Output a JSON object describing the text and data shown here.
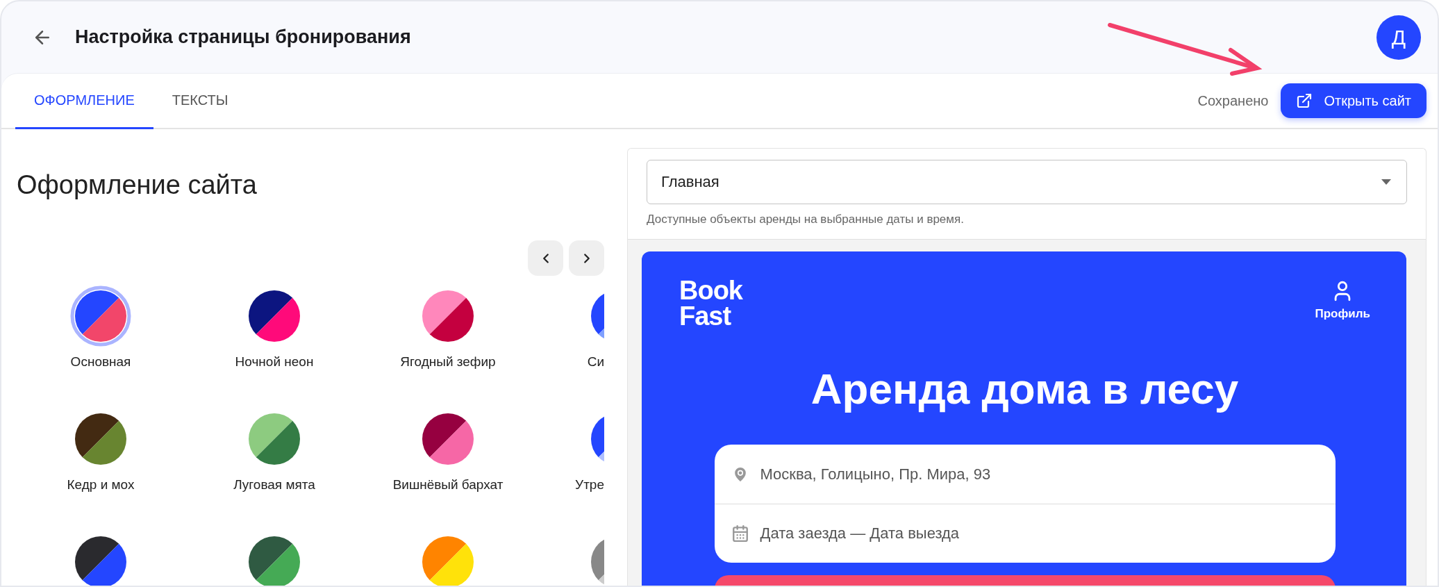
{
  "header": {
    "title": "Настройка страницы бронирования",
    "avatar": "Д"
  },
  "tabs": [
    {
      "label": "ОФОРМЛЕНИЕ",
      "selected": true
    },
    {
      "label": "ТЕКСТЫ",
      "selected": false
    }
  ],
  "save_status": "Сохранено",
  "open_site_button": "Открыть сайт",
  "design": {
    "title": "Оформление сайта",
    "themes": [
      {
        "label": "Основная",
        "halves": [
          {
            "color": "#2446ff"
          },
          {
            "color": "#f2466a"
          }
        ],
        "selected": true
      },
      {
        "label": "Ночной неон",
        "halves": [
          {
            "color": "#0c1580"
          },
          {
            "color": "#ff0a7a"
          }
        ],
        "selected": false
      },
      {
        "label": "Ягодный зефир",
        "halves": [
          {
            "color": "#ff87bb"
          },
          {
            "color": "#c4003f"
          }
        ],
        "selected": false
      },
      {
        "label": "Си",
        "halves": [
          {
            "color": "#2446ff"
          },
          {
            "color": "#7fa0ff"
          }
        ],
        "selected": false
      },
      {
        "label": "Кедр и мох",
        "halves": [
          {
            "color": "#432a12"
          },
          {
            "color": "#688530"
          }
        ],
        "selected": false
      },
      {
        "label": "Луговая мята",
        "halves": [
          {
            "color": "#8dcb80"
          },
          {
            "color": "#347c45"
          }
        ],
        "selected": false
      },
      {
        "label": "Вишнёвый бархат",
        "halves": [
          {
            "color": "#960040"
          },
          {
            "color": "#f667a6"
          }
        ],
        "selected": false
      },
      {
        "label": "Утре",
        "halves": [
          {
            "color": "#2446ff"
          },
          {
            "color": "#b0c0ff"
          }
        ],
        "selected": false
      },
      {
        "halves": [
          {
            "color": "#2a2a2e"
          },
          {
            "color": "#2446ff"
          }
        ],
        "selected": false
      },
      {
        "halves": [
          {
            "color": "#2f5a42"
          },
          {
            "color": "#45aa55"
          }
        ],
        "selected": false
      },
      {
        "halves": [
          {
            "color": "#ff8400"
          },
          {
            "color": "#ffe20a"
          }
        ],
        "selected": false
      },
      {
        "halves": [
          {
            "color": "#888888"
          },
          {
            "color": "#cccccc"
          }
        ],
        "selected": false
      }
    ]
  },
  "preview": {
    "page_select": {
      "value": "Главная",
      "helper": "Доступные объекты аренды на выбранные даты и время."
    },
    "logo": [
      "Book",
      "Fast"
    ],
    "profile": "Профиль",
    "heading": "Аренда дома в лесу",
    "search": {
      "location": "Москва, Голицыно, Пр. Мира, 93",
      "dates": "Дата заезда — Дата выезда"
    }
  }
}
